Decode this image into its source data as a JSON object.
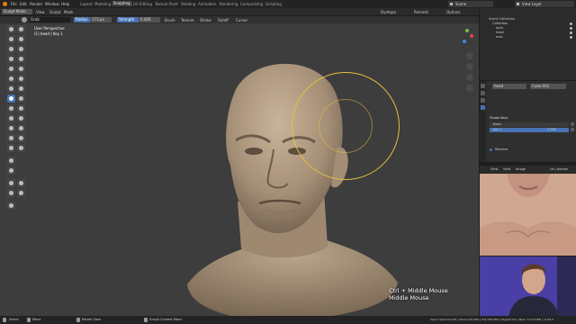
{
  "menubar": {
    "menus": [
      "File",
      "Edit",
      "Render",
      "Window",
      "Help"
    ],
    "workspaces": [
      "Layout",
      "Modeling",
      "Sculpting",
      "UV Editing",
      "Texture Paint",
      "Shading",
      "Animation",
      "Rendering",
      "Compositing",
      "Scripting"
    ],
    "active_workspace": "Sculpting",
    "scene": "Scene",
    "view_layer": "View Layer"
  },
  "tool_header": {
    "brush_name": "Grab",
    "radius_label": "Radius",
    "radius_value": "173 px",
    "strength_label": "Strength",
    "strength_value": "0.400",
    "brush_menu": "Brush",
    "texture_menu": "Texture",
    "stroke_menu": "Stroke",
    "falloff_menu": "Falloff",
    "cursor_menu": "Cursor"
  },
  "view_header": {
    "mode": "Sculpt Mode",
    "menus": [
      "View",
      "Sculpt",
      "Mask"
    ],
    "options": [
      "Dyntopo",
      "Remesh",
      "Options"
    ]
  },
  "viewport": {
    "view_name": "User Perspective",
    "object_name": "(1) head | Key 1"
  },
  "key_overlay": {
    "line1": "Ctrl + Middle Mouse",
    "line2": "Middle Mouse"
  },
  "outliner": {
    "title": "Scene Collection",
    "items": [
      "Collection",
      "eyes",
      "head",
      "max"
    ]
  },
  "properties": {
    "object_field": "head",
    "mesh_field": "Cube.002",
    "shape_keys_title": "Shape Keys",
    "shape_keys": [
      {
        "name": "Basis",
        "value": ""
      },
      {
        "name": "Key 1",
        "value": "1.000"
      }
    ]
  },
  "image_editor": {
    "title": "Relative",
    "menus": [
      "View",
      "View",
      "Image"
    ],
    "image_name": "ctrl_woman"
  },
  "statusbar": {
    "select": "Select",
    "move": "Move",
    "rotate_view": "Rotate View",
    "context_menu": "Sculpt Context Menu",
    "stats": "head | Verts:54,291 | Faces:107,996 | Tris:108,556 | Objects:0/3 | Mem: 172.8 MiB | v2.83.3"
  },
  "colors": {
    "accent": "#4772b3",
    "viewport_bg": "#3d3d3d",
    "panel_bg": "#2b2b2b",
    "brush_circle": "#e8c13a"
  }
}
